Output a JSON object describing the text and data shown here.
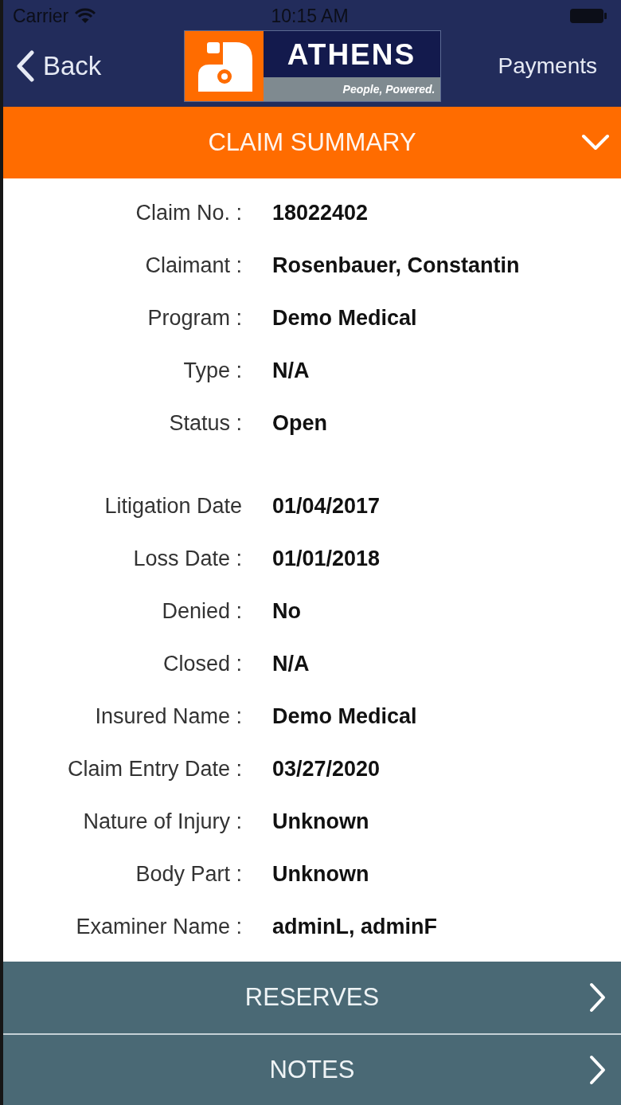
{
  "status_bar": {
    "carrier": "Carrier",
    "time": "10:15 AM"
  },
  "nav_bar": {
    "back": "Back",
    "logo": {
      "name": "ATHENS",
      "tagline": "People, Powered."
    },
    "action": "Payments"
  },
  "section": {
    "title": "CLAIM SUMMARY",
    "expanded": true
  },
  "field_groups": [
    {
      "fields": [
        {
          "label": "Claim No. :",
          "value": "18022402"
        },
        {
          "label": "Claimant :",
          "value": "Rosenbauer, Constantin"
        },
        {
          "label": "Program :",
          "value": "Demo Medical"
        },
        {
          "label": "Type :",
          "value": "N/A"
        },
        {
          "label": "Status :",
          "value": "Open"
        }
      ]
    },
    {
      "fields": [
        {
          "label": "Litigation Date",
          "value": "01/04/2017"
        },
        {
          "label": "Loss Date :",
          "value": "01/01/2018"
        },
        {
          "label": "Denied :",
          "value": "No"
        },
        {
          "label": "Closed :",
          "value": "N/A"
        },
        {
          "label": "Insured Name :",
          "value": "Demo Medical"
        },
        {
          "label": "Claim Entry Date :",
          "value": "03/27/2020"
        },
        {
          "label": "Nature of Injury :",
          "value": "Unknown"
        },
        {
          "label": "Body Part :",
          "value": "Unknown"
        },
        {
          "label": "Examiner Name :",
          "value": "adminL, adminF"
        }
      ]
    }
  ],
  "links": [
    {
      "label": "RESERVES"
    },
    {
      "label": "NOTES"
    }
  ]
}
